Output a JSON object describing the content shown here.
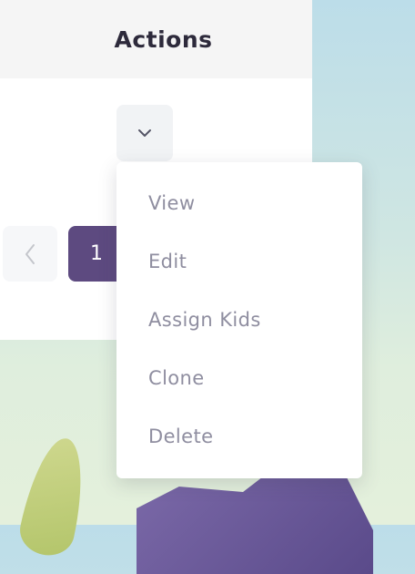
{
  "header": {
    "title": "Actions"
  },
  "dropdown": {
    "toggle_icon": "chevron-down-icon",
    "items": [
      {
        "label": "View"
      },
      {
        "label": "Edit"
      },
      {
        "label": "Assign Kids"
      },
      {
        "label": "Clone"
      },
      {
        "label": "Delete"
      }
    ]
  },
  "pagination": {
    "prev_icon": "chevron-left-icon",
    "current_page": "1"
  },
  "colors": {
    "accent": "#5d4a80",
    "menu_text": "#8f8ea0",
    "header_bg": "#f5f5f5"
  }
}
